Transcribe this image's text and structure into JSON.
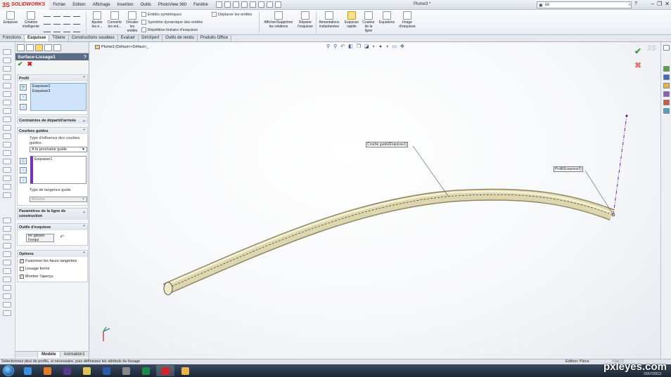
{
  "app": {
    "logo_mark": "3S",
    "logo_text": "SOLIDWORKS",
    "doc_title": "Plume3 *",
    "search_value": "us",
    "help_symbol": "?",
    "min_symbol": "–",
    "max_symbol": "❐",
    "close_symbol": "✕"
  },
  "menu": [
    "Fichier",
    "Edition",
    "Affichage",
    "Insertion",
    "Outils",
    "PhotoView 360",
    "Fenêtre"
  ],
  "ribbon": {
    "esquisse": "Esquisse",
    "cotation": "Cotation intelligente",
    "ajuster": "Ajuster les e...",
    "convertir": "Convertir les ent...",
    "decaler": "Décaler les entités",
    "symetriques": "Entités symétriques",
    "symetrie_dyn": "Symétrie dynamique des entités",
    "repetition": "Répétition linéaire d'esquisse",
    "deplacer": "Déplacer les entités",
    "afficher_relations": "Afficher/Supprimer les relations",
    "reparer": "Réparer l'esquisse",
    "aimantations": "Aimantations instantanées",
    "esquisse_rapide": "Esquisse rapide",
    "couleur": "Couleur de la ligne",
    "equations": "Equations",
    "image": "Image d'esquisse"
  },
  "tabs": [
    "Fonctions",
    "Esquisse",
    "Tôlerie",
    "Constructions soudées",
    "Evaluer",
    "DimXpert",
    "Outils de rendu",
    "Produits Office"
  ],
  "panel": {
    "feature_title": "Surface-Lissage1",
    "help": "?",
    "groups": {
      "profil": "Profil",
      "contraintes": "Contraintes de départ/d'arrivée",
      "courbes": "Courbes guides",
      "parametres": "Paramètres de la ligne de construction",
      "outils": "Outils d'esquisse",
      "options": "Options"
    },
    "profile_items": [
      "Esquisse2",
      "Esquisse3"
    ],
    "influence_label": "Type d'influence des courbes guides:",
    "influence_value": "A la prochaine guide",
    "guide_items": [
      "Esquisse1"
    ],
    "tangence_label": "Type de tangence guide",
    "tangence_value": "Aucune",
    "glisser_label": "ire glisser l'esqui",
    "opt_fusionner": "Fusionner les faces tangentes",
    "opt_lissage": "Lissage fermé",
    "opt_apercu": "Montrer l'aperçu",
    "bottom_tabs": [
      "Modèle",
      "Animation1"
    ]
  },
  "graphics": {
    "tree_label": "Plume3 (Défaut<<Défaut>_",
    "callout_guide": "Courbe guide(Esquisse1)",
    "callout_profil": "Profil(Esquisse3)",
    "watermark": "3S"
  },
  "status": {
    "message": "Sélectionnez plus de profils, si nécessaire, puis définissez les attributs du lissage",
    "mode": "Edition: Pièce",
    "units": "MMGS"
  },
  "watermark_site": "pxleyes.com",
  "watermark_date": "20/07/2013",
  "colors": {
    "sw_red": "#d2232a",
    "panel_header": "#5b6a85",
    "profile_selection": "#cfe3fb",
    "tube": "#d6cfa6",
    "guide_curve": "#6a23b8"
  }
}
